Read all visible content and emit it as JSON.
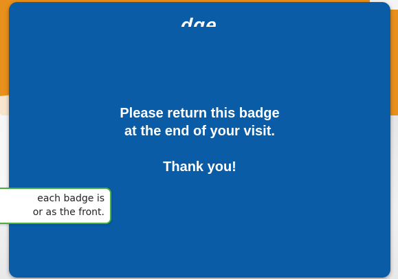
{
  "badge": {
    "header_fragment": "dge",
    "message_line_1": "Please return this badge",
    "message_line_2": "at the end of your visit.",
    "thanks": "Thank you!"
  },
  "callout": {
    "line_1": "each badge is",
    "line_2": "or as the front."
  },
  "colors": {
    "badge_blue": "#0a5ca6",
    "orange": "#e8901c",
    "callout_border": "#4caf3a"
  }
}
